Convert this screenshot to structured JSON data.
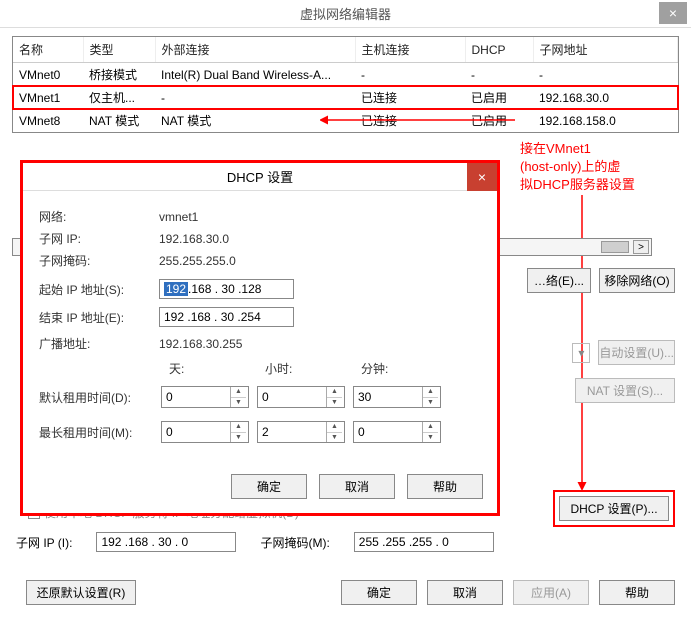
{
  "window": {
    "title": "虚拟网络编辑器"
  },
  "table": {
    "headers": {
      "name": "名称",
      "type": "类型",
      "ext": "外部连接",
      "host": "主机连接",
      "dhcp": "DHCP",
      "subnet": "子网地址"
    },
    "rows": [
      {
        "name": "VMnet0",
        "type": "桥接模式",
        "ext": "Intel(R) Dual Band Wireless-A...",
        "host": "-",
        "dhcp": "-",
        "subnet": "-"
      },
      {
        "name": "VMnet1",
        "type": "仅主机...",
        "ext": "-",
        "host": "已连接",
        "dhcp": "已启用",
        "subnet": "192.168.30.0"
      },
      {
        "name": "VMnet8",
        "type": "NAT 模式",
        "ext": "NAT 模式",
        "host": "已连接",
        "dhcp": "已启用",
        "subnet": "192.168.158.0"
      }
    ]
  },
  "buttons": {
    "add_net": "…络(E)...",
    "remove_net": "移除网络(O)",
    "auto": "自动设置(U)...",
    "nat": "NAT 设置(S)...",
    "dhcp": "DHCP 设置(P)...",
    "restore": "还原默认设置(R)",
    "ok": "确定",
    "cancel": "取消",
    "apply": "应用(A)",
    "help": "帮助"
  },
  "annotation": {
    "text1": "接在VMnet1",
    "text2": "(host-only)上的虚",
    "text3": "拟DHCP服务器设置"
  },
  "dhcp_dialog": {
    "title": "DHCP 设置",
    "labels": {
      "network": "网络:",
      "subnet_ip": "子网 IP:",
      "mask": "子网掩码:",
      "start_ip": "起始 IP 地址(S):",
      "end_ip": "结束 IP 地址(E):",
      "broadcast": "广播地址:",
      "days": "天:",
      "hours": "小时:",
      "minutes": "分钟:",
      "def_lease": "默认租用时间(D):",
      "max_lease": "最长租用时间(M):"
    },
    "values": {
      "network": "vmnet1",
      "subnet_ip": "192.168.30.0",
      "mask": "255.255.255.0",
      "start_seg1": "192",
      "start_rest": ".168 . 30 .128",
      "end_ip": "192 .168 . 30 .254",
      "broadcast": "192.168.30.255",
      "def_d": "0",
      "def_h": "0",
      "def_m": "30",
      "max_d": "0",
      "max_h": "2",
      "max_m": "0"
    },
    "btns": {
      "ok": "确定",
      "cancel": "取消",
      "help": "帮助"
    }
  },
  "bottom": {
    "checkbox_partial": "使用本地 DHCP 服务将 IP 地址分配给虚拟机(D)",
    "subnet_ip_label": "子网 IP (I):",
    "subnet_ip_val": "192 .168 . 30 .  0",
    "mask_label": "子网掩码(M):",
    "mask_val": "255 .255 .255 .  0"
  },
  "misc": {
    "dropdown_caret": "▾",
    "scroll_right": ">"
  }
}
